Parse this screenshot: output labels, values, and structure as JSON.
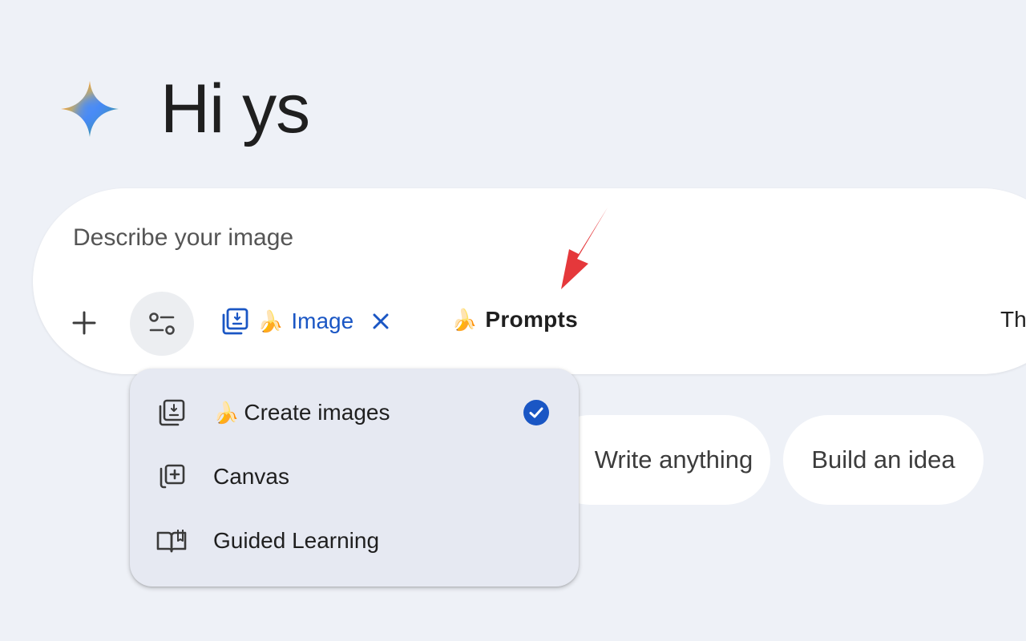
{
  "greeting": {
    "text": "Hi ys",
    "logo_icon": "gemini-sparkle-icon"
  },
  "prompt": {
    "placeholder": "Describe your image",
    "add_icon": "plus-icon",
    "tools_icon": "tools-sliders-icon",
    "image_chip": {
      "icon": "image-gallery-icon",
      "emoji": "🍌",
      "label": "Image",
      "close_icon": "close-icon",
      "color": "#1a56c4"
    },
    "prompts_chip": {
      "emoji": "🍌",
      "label": "Prompts"
    },
    "cut_text": "Th"
  },
  "annotation": {
    "icon": "red-arrow-icon",
    "color": "#e5383b"
  },
  "suggestions": [
    {
      "label": "Write anything"
    },
    {
      "label": "Build an idea"
    }
  ],
  "tools_menu": {
    "items": [
      {
        "icon": "image-gallery-icon",
        "emoji": "🍌",
        "label": "Create images",
        "selected": true
      },
      {
        "icon": "canvas-icon",
        "label": "Canvas",
        "selected": false
      },
      {
        "icon": "book-open-icon",
        "label": "Guided Learning",
        "selected": false
      }
    ],
    "check_icon": "check-circle-icon",
    "check_color": "#1a56c4"
  }
}
